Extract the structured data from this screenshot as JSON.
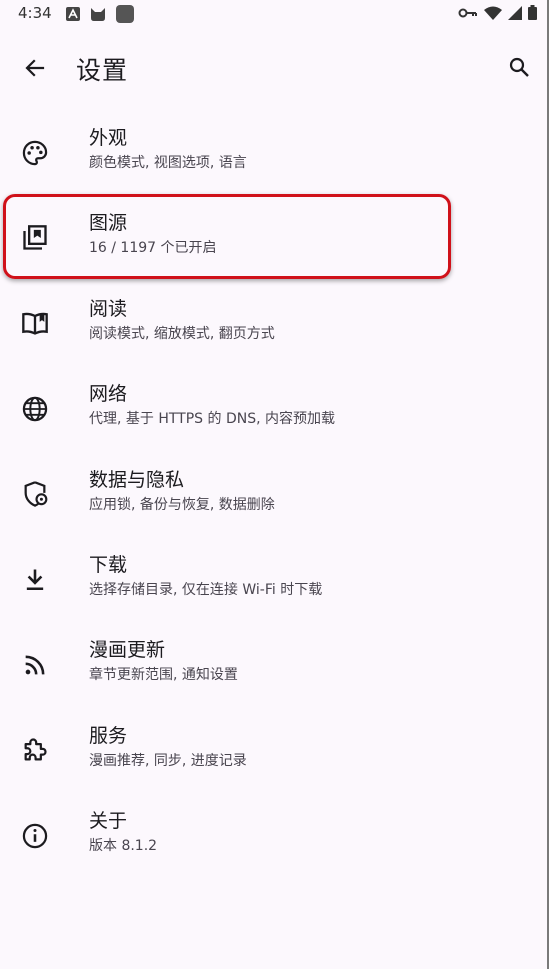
{
  "status_bar": {
    "time": "4:34",
    "left_icons": [
      "font-a-icon",
      "cat-icon",
      "app-square-icon"
    ],
    "right_icons": [
      "key-icon",
      "wifi-icon",
      "signal-icon",
      "battery-icon"
    ]
  },
  "app_bar": {
    "back_icon": "arrow-back-icon",
    "title": "设置",
    "search_icon": "search-icon"
  },
  "settings": {
    "items": [
      {
        "icon": "palette-icon",
        "title": "外观",
        "subtitle": "颜色模式, 视图选项, 语言"
      },
      {
        "icon": "library-icon",
        "title": "图源",
        "subtitle": "16 / 1197 个已开启"
      },
      {
        "icon": "book-open-icon",
        "title": "阅读",
        "subtitle": "阅读模式, 缩放模式, 翻页方式"
      },
      {
        "icon": "globe-icon",
        "title": "网络",
        "subtitle": "代理, 基于 HTTPS 的 DNS, 内容预加载"
      },
      {
        "icon": "shield-lock-icon",
        "title": "数据与隐私",
        "subtitle": "应用锁, 备份与恢复, 数据删除"
      },
      {
        "icon": "download-icon",
        "title": "下载",
        "subtitle": "选择存储目录, 仅在连接 Wi-Fi 时下载"
      },
      {
        "icon": "rss-icon",
        "title": "漫画更新",
        "subtitle": "章节更新范围, 通知设置"
      },
      {
        "icon": "extension-icon",
        "title": "服务",
        "subtitle": "漫画推荐, 同步, 进度记录"
      },
      {
        "icon": "info-icon",
        "title": "关于",
        "subtitle": "版本 8.1.2"
      }
    ]
  },
  "colors": {
    "background": "#fcf8fd",
    "text_primary": "#1c1b1f",
    "text_secondary": "#49454f",
    "highlight": "#d0111a"
  }
}
